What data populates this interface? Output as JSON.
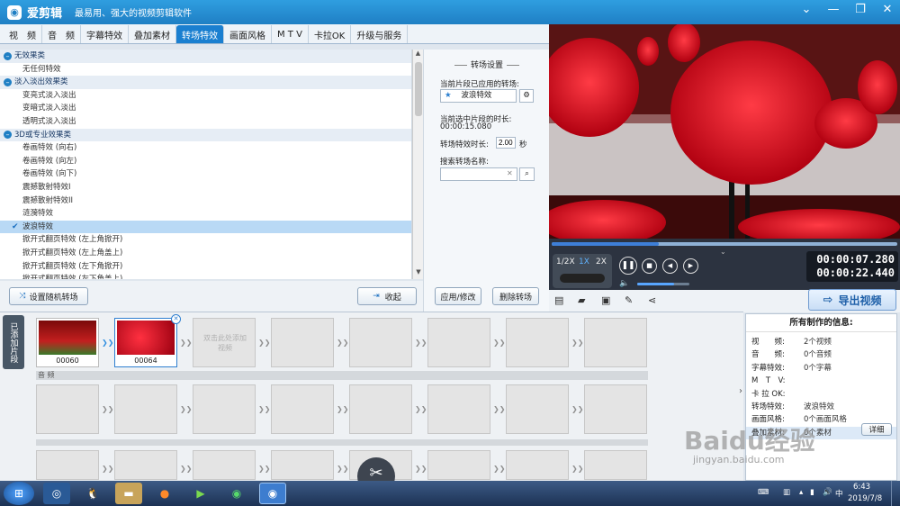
{
  "app": {
    "name": "爱剪辑",
    "slogan": "最易用、强大的视频剪辑软件",
    "window_controls": [
      "chevron-down-icon",
      "minimize-icon",
      "restore-icon",
      "close-icon"
    ]
  },
  "tabs": [
    {
      "label": "视　频"
    },
    {
      "label": "音　频"
    },
    {
      "label": "字幕特效"
    },
    {
      "label": "叠加素材"
    },
    {
      "label": "转场特效",
      "active": true
    },
    {
      "label": "画面风格"
    },
    {
      "label": "M T V"
    },
    {
      "label": "卡拉OK"
    },
    {
      "label": "升级与服务"
    }
  ],
  "effects": {
    "categories": [
      {
        "name": "无效果类",
        "items": [
          "无任何特效"
        ]
      },
      {
        "name": "淡入淡出效果类",
        "items": [
          "变亮式淡入淡出",
          "变暗式淡入淡出",
          "透明式淡入淡出"
        ]
      },
      {
        "name": "3D或专业效果类",
        "items": [
          "卷画特效 (向右)",
          "卷画特效 (向左)",
          "卷画特效 (向下)",
          "震撼散射特效I",
          "震撼散射特效II",
          "涟漪特效",
          "波浪特效",
          "掀开式翻页特效 (左上角掀开)",
          "掀开式翻页特效 (左上角盖上)",
          "掀开式翻页特效 (左下角掀开)",
          "掀开式翻页特效 (左下角盖上)"
        ]
      }
    ],
    "selected": "波浪特效"
  },
  "list_buttons": {
    "random": "设置随机转场",
    "collapse": "收起"
  },
  "settings": {
    "header": "转场设置",
    "applied_label": "当前片段已应用的转场:",
    "applied_value": "波浪特效",
    "duration_label": "当前选中片段的时长:",
    "duration_value": "00:00:15.080",
    "effect_duration_label": "转场特效时长:",
    "effect_duration_value": "2.00",
    "effect_duration_unit": "秒",
    "search_label": "搜索转场名称:",
    "search_value": "",
    "apply_button": "应用/修改",
    "delete_button": "删除转场"
  },
  "player": {
    "speeds": [
      "1/2X",
      "1X",
      "2X"
    ],
    "active_speed": "1X",
    "time_current": "00:00:07.280",
    "time_total": "00:00:22.440",
    "export_button": "导出视频",
    "progress": 0.31,
    "volume": 0.7
  },
  "timeline": {
    "side_tab": "已添加片段",
    "clips": [
      {
        "label": "00060"
      },
      {
        "label": "00064"
      }
    ],
    "add_hint": "双击此处添加视频",
    "audio_label": "音 频"
  },
  "info": {
    "title": "所有制作的信息:",
    "rows": [
      {
        "k": "视　　频:",
        "v": "2个视频"
      },
      {
        "k": "音　　频:",
        "v": "0个音频"
      },
      {
        "k": "字幕特效:",
        "v": "0个字幕"
      },
      {
        "k": "M　T　V:",
        "v": ""
      },
      {
        "k": "卡 拉 OK:",
        "v": ""
      },
      {
        "k": "转场特效:",
        "v": "波浪特效"
      },
      {
        "k": "画面风格:",
        "v": "0个画面风格"
      },
      {
        "k": "叠加素材:",
        "v": "0个素材"
      }
    ],
    "detail_button": "详细"
  },
  "taskbar": {
    "time": "6:43",
    "date": "2019/7/8"
  },
  "watermark": {
    "brand": "Baidu经验",
    "url": "jingyan.baidu.com"
  }
}
